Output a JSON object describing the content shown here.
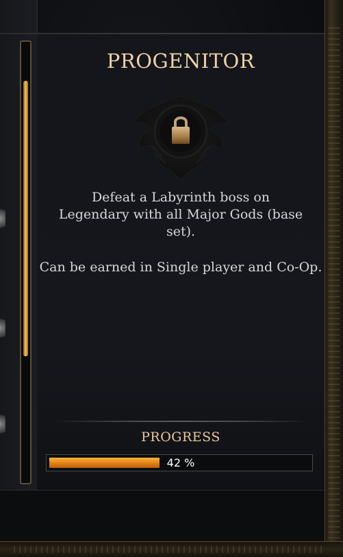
{
  "achievement": {
    "title": "PROGENITOR",
    "locked": true,
    "description": "Defeat a Labyrinth boss on Legendary with all Major Gods (base set).",
    "availability": "Can be earned in Single player and Co-Op."
  },
  "progress": {
    "label": "PROGRESS",
    "value_text": "42 %",
    "fraction": 0.42
  },
  "icons": {
    "emblem": "winged-crest-emblem-icon",
    "lock": "padlock-icon"
  },
  "colors": {
    "title": "#f0d2a8",
    "progress_fill": "#e8891a",
    "scroll_thumb": "#f6c55a"
  }
}
